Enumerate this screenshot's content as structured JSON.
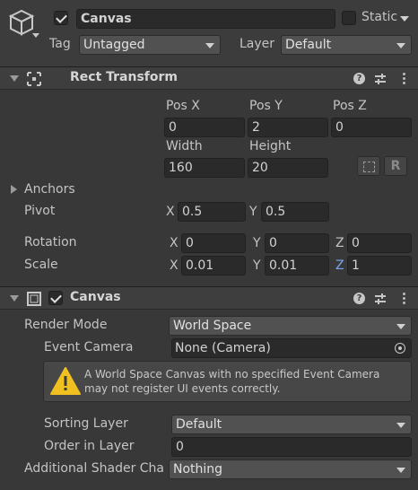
{
  "object": {
    "name": "Canvas",
    "active": true,
    "static_label": "Static",
    "static_checked": false,
    "tag_label": "Tag",
    "tag_value": "Untagged",
    "layer_label": "Layer",
    "layer_value": "Default",
    "icon": "cube-icon"
  },
  "rect_transform": {
    "title": "Rect Transform",
    "icon": "rect-transform-icon",
    "pos_x_label": "Pos X",
    "pos_y_label": "Pos Y",
    "pos_z_label": "Pos Z",
    "pos_x": "0",
    "pos_y": "2",
    "pos_z": "0",
    "width_label": "Width",
    "height_label": "Height",
    "width": "160",
    "height": "20",
    "blueprint_icon": "blueprint-mode-icon",
    "raw_edit_label": "R",
    "anchors_label": "Anchors",
    "pivot_label": "Pivot",
    "pivot_x_axis": "X",
    "pivot_y_axis": "Y",
    "pivot_x": "0.5",
    "pivot_y": "0.5",
    "rotation_label": "Rotation",
    "rot_x_axis": "X",
    "rot_y_axis": "Y",
    "rot_z_axis": "Z",
    "rot_x": "0",
    "rot_y": "0",
    "rot_z": "0",
    "scale_label": "Scale",
    "scale_x_axis": "X",
    "scale_y_axis": "Y",
    "scale_z_axis": "Z",
    "scale_x": "0.01",
    "scale_y": "0.01",
    "scale_z": "1"
  },
  "canvas": {
    "title": "Canvas",
    "enabled": true,
    "icon": "canvas-component-icon",
    "render_mode_label": "Render Mode",
    "render_mode_value": "World Space",
    "event_camera_label": "Event Camera",
    "event_camera_value": "None (Camera)",
    "object_picker_icon": "object-picker-icon",
    "warning_icon": "warning-icon",
    "warning_line1": "A World Space Canvas with no specified Event Camera",
    "warning_line2": "may not register UI events correctly.",
    "sorting_layer_label": "Sorting Layer",
    "sorting_layer_value": "Default",
    "order_in_layer_label": "Order in Layer",
    "order_in_layer_value": "0",
    "additional_shader_label": "Additional Shader Cha",
    "additional_shader_value": "Nothing"
  },
  "colors": {
    "background": "#383838",
    "header": "#3e3e3e",
    "field": "#2a2a2a",
    "dropdown": "#515151",
    "z_axis_blue": "#7aa6f0",
    "warning_yellow": "#f0c020"
  }
}
